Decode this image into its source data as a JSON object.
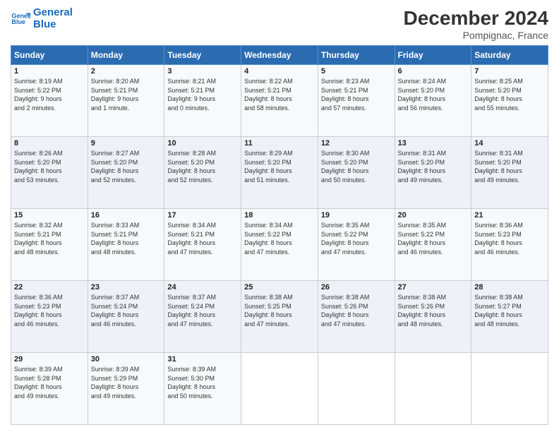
{
  "header": {
    "logo_line1": "General",
    "logo_line2": "Blue",
    "main_title": "December 2024",
    "subtitle": "Pompignac, France"
  },
  "days_of_week": [
    "Sunday",
    "Monday",
    "Tuesday",
    "Wednesday",
    "Thursday",
    "Friday",
    "Saturday"
  ],
  "weeks": [
    [
      {
        "day": "1",
        "detail": "Sunrise: 8:19 AM\nSunset: 5:22 PM\nDaylight: 9 hours\nand 2 minutes."
      },
      {
        "day": "2",
        "detail": "Sunrise: 8:20 AM\nSunset: 5:21 PM\nDaylight: 9 hours\nand 1 minute."
      },
      {
        "day": "3",
        "detail": "Sunrise: 8:21 AM\nSunset: 5:21 PM\nDaylight: 9 hours\nand 0 minutes."
      },
      {
        "day": "4",
        "detail": "Sunrise: 8:22 AM\nSunset: 5:21 PM\nDaylight: 8 hours\nand 58 minutes."
      },
      {
        "day": "5",
        "detail": "Sunrise: 8:23 AM\nSunset: 5:21 PM\nDaylight: 8 hours\nand 57 minutes."
      },
      {
        "day": "6",
        "detail": "Sunrise: 8:24 AM\nSunset: 5:20 PM\nDaylight: 8 hours\nand 56 minutes."
      },
      {
        "day": "7",
        "detail": "Sunrise: 8:25 AM\nSunset: 5:20 PM\nDaylight: 8 hours\nand 55 minutes."
      }
    ],
    [
      {
        "day": "8",
        "detail": "Sunrise: 8:26 AM\nSunset: 5:20 PM\nDaylight: 8 hours\nand 53 minutes."
      },
      {
        "day": "9",
        "detail": "Sunrise: 8:27 AM\nSunset: 5:20 PM\nDaylight: 8 hours\nand 52 minutes."
      },
      {
        "day": "10",
        "detail": "Sunrise: 8:28 AM\nSunset: 5:20 PM\nDaylight: 8 hours\nand 52 minutes."
      },
      {
        "day": "11",
        "detail": "Sunrise: 8:29 AM\nSunset: 5:20 PM\nDaylight: 8 hours\nand 51 minutes."
      },
      {
        "day": "12",
        "detail": "Sunrise: 8:30 AM\nSunset: 5:20 PM\nDaylight: 8 hours\nand 50 minutes."
      },
      {
        "day": "13",
        "detail": "Sunrise: 8:31 AM\nSunset: 5:20 PM\nDaylight: 8 hours\nand 49 minutes."
      },
      {
        "day": "14",
        "detail": "Sunrise: 8:31 AM\nSunset: 5:20 PM\nDaylight: 8 hours\nand 49 minutes."
      }
    ],
    [
      {
        "day": "15",
        "detail": "Sunrise: 8:32 AM\nSunset: 5:21 PM\nDaylight: 8 hours\nand 48 minutes."
      },
      {
        "day": "16",
        "detail": "Sunrise: 8:33 AM\nSunset: 5:21 PM\nDaylight: 8 hours\nand 48 minutes."
      },
      {
        "day": "17",
        "detail": "Sunrise: 8:34 AM\nSunset: 5:21 PM\nDaylight: 8 hours\nand 47 minutes."
      },
      {
        "day": "18",
        "detail": "Sunrise: 8:34 AM\nSunset: 5:22 PM\nDaylight: 8 hours\nand 47 minutes."
      },
      {
        "day": "19",
        "detail": "Sunrise: 8:35 AM\nSunset: 5:22 PM\nDaylight: 8 hours\nand 47 minutes."
      },
      {
        "day": "20",
        "detail": "Sunrise: 8:35 AM\nSunset: 5:22 PM\nDaylight: 8 hours\nand 46 minutes."
      },
      {
        "day": "21",
        "detail": "Sunrise: 8:36 AM\nSunset: 5:23 PM\nDaylight: 8 hours\nand 46 minutes."
      }
    ],
    [
      {
        "day": "22",
        "detail": "Sunrise: 8:36 AM\nSunset: 5:23 PM\nDaylight: 8 hours\nand 46 minutes."
      },
      {
        "day": "23",
        "detail": "Sunrise: 8:37 AM\nSunset: 5:24 PM\nDaylight: 8 hours\nand 46 minutes."
      },
      {
        "day": "24",
        "detail": "Sunrise: 8:37 AM\nSunset: 5:24 PM\nDaylight: 8 hours\nand 47 minutes."
      },
      {
        "day": "25",
        "detail": "Sunrise: 8:38 AM\nSunset: 5:25 PM\nDaylight: 8 hours\nand 47 minutes."
      },
      {
        "day": "26",
        "detail": "Sunrise: 8:38 AM\nSunset: 5:26 PM\nDaylight: 8 hours\nand 47 minutes."
      },
      {
        "day": "27",
        "detail": "Sunrise: 8:38 AM\nSunset: 5:26 PM\nDaylight: 8 hours\nand 48 minutes."
      },
      {
        "day": "28",
        "detail": "Sunrise: 8:38 AM\nSunset: 5:27 PM\nDaylight: 8 hours\nand 48 minutes."
      }
    ],
    [
      {
        "day": "29",
        "detail": "Sunrise: 8:39 AM\nSunset: 5:28 PM\nDaylight: 8 hours\nand 49 minutes."
      },
      {
        "day": "30",
        "detail": "Sunrise: 8:39 AM\nSunset: 5:29 PM\nDaylight: 8 hours\nand 49 minutes."
      },
      {
        "day": "31",
        "detail": "Sunrise: 8:39 AM\nSunset: 5:30 PM\nDaylight: 8 hours\nand 50 minutes."
      },
      null,
      null,
      null,
      null
    ]
  ]
}
